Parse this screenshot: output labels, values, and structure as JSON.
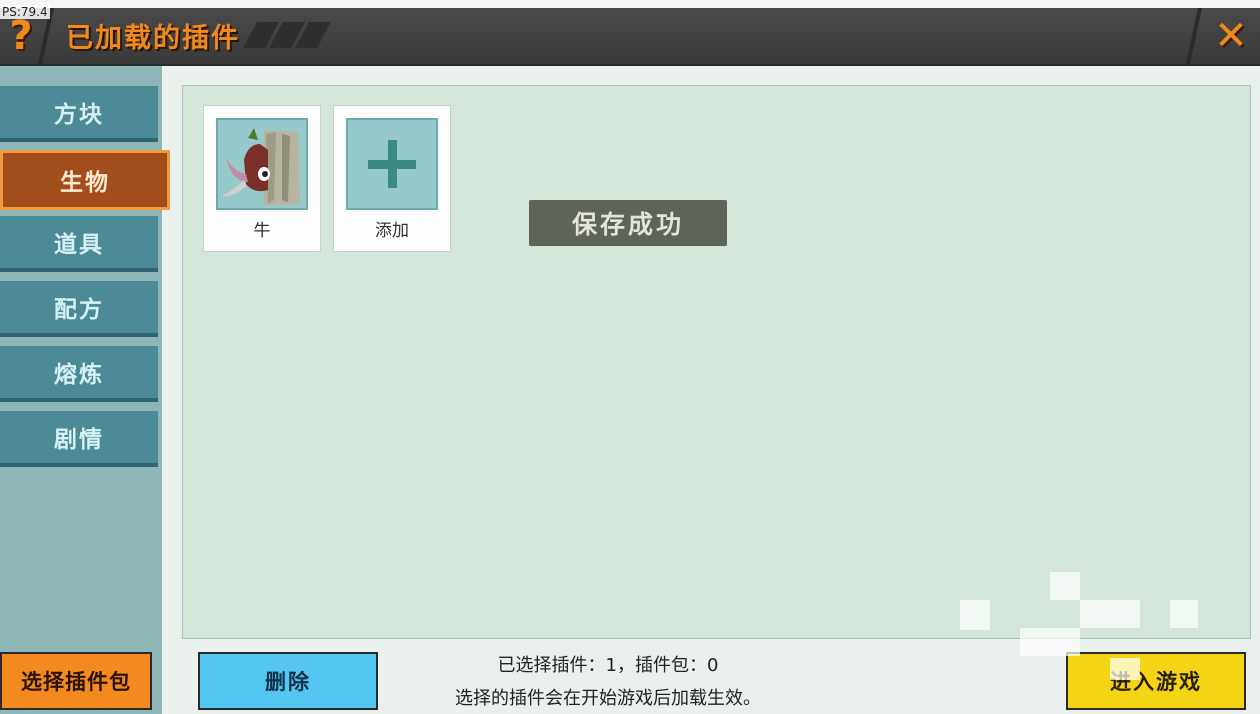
{
  "overlay": {
    "fps": "PS:79.4"
  },
  "header": {
    "title": "已加载的插件",
    "help_icon": "?",
    "close_icon": "✕"
  },
  "sidebar": {
    "tabs": [
      {
        "label": "方块",
        "active": false
      },
      {
        "label": "生物",
        "active": true
      },
      {
        "label": "道具",
        "active": false
      },
      {
        "label": "配方",
        "active": false
      },
      {
        "label": "熔炼",
        "active": false
      },
      {
        "label": "剧情",
        "active": false
      }
    ],
    "select_pack_label": "选择插件包"
  },
  "plugins": [
    {
      "name": "牛",
      "icon": "cow-creature-icon"
    },
    {
      "name": "添加",
      "icon": "plus-icon"
    }
  ],
  "toast": "保存成功",
  "footer": {
    "delete_label": "删除",
    "selected_info": "已选择插件：1，插件包：0",
    "hint": "选择的插件会在开始游戏后加载生效。",
    "play_label": "进入游戏"
  },
  "colors": {
    "accent": "#f08a1e",
    "tab": "#4c8a96",
    "tab_active": "#a24d1c",
    "panel": "#d3e6d9",
    "play": "#f4d516",
    "delete": "#55c6f2"
  }
}
